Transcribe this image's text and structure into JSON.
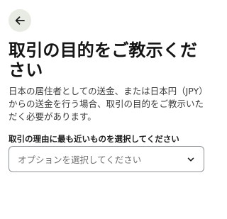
{
  "header": {
    "back_icon": "arrow-left-icon"
  },
  "main": {
    "title": "取引の目的をご教示ください",
    "description": "日本の居住者としての送金、または日本円（JPY）からの送金を行う場合、取引の目的をご教示いただく必要があります。",
    "field": {
      "label": "取引の理由に最も近いものを選択してください",
      "placeholder": "オプションを選択してください",
      "icon": "chevron-down-icon"
    }
  },
  "colors": {
    "back_button_bg": "#e8ebe3",
    "border": "#8e9196",
    "text": "#1b1b1b"
  }
}
